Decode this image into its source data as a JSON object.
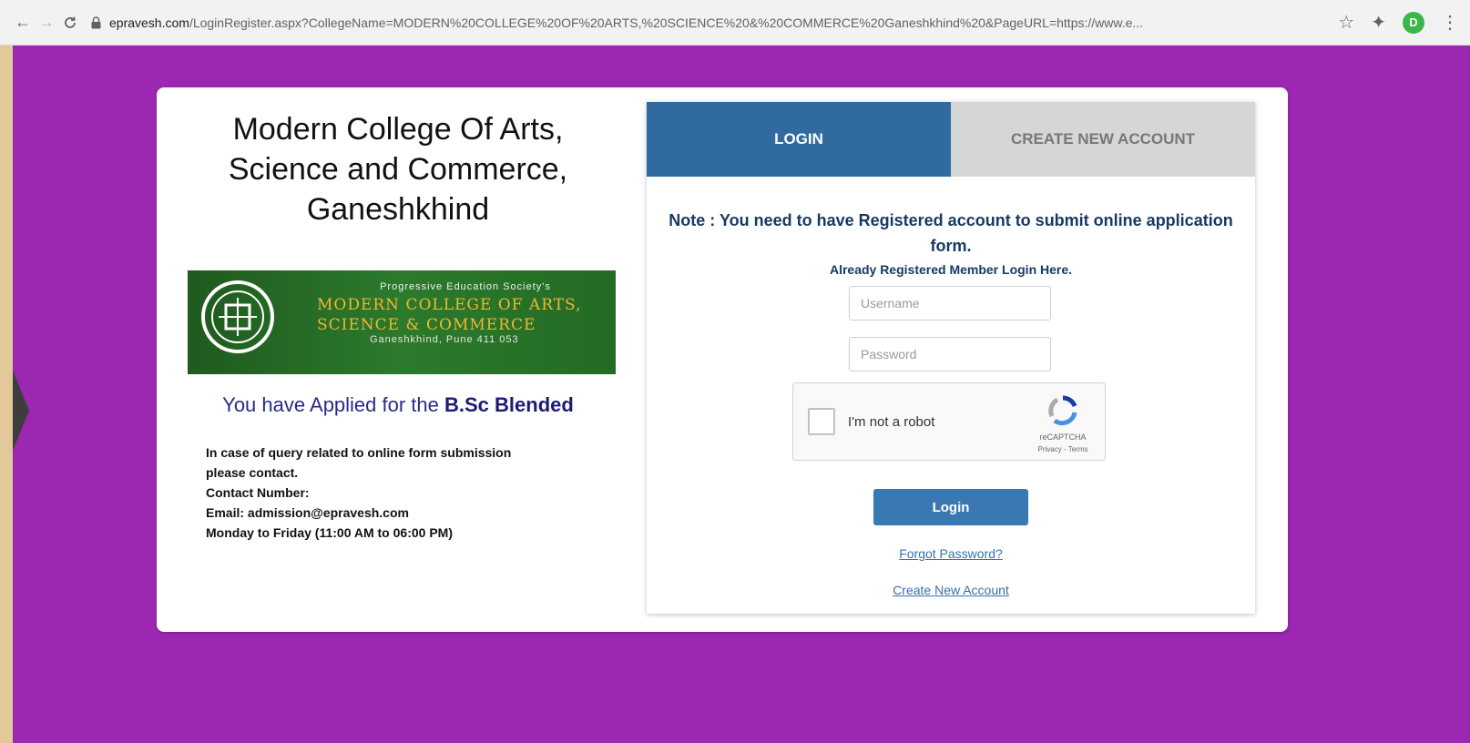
{
  "browser": {
    "url_host": "epravesh.com",
    "url_rest": "/LoginRegister.aspx?CollegeName=MODERN%20COLLEGE%20OF%20ARTS,%20SCIENCE%20&%20COMMERCE%20Ganeshkhind%20&PageURL=https://www.e...",
    "back_glyph": "←",
    "forward_glyph": "→",
    "reload_glyph": "C",
    "profile_initial": "D"
  },
  "college": {
    "title": "Modern College Of Arts, Science and Commerce, Ganeshkhind",
    "banner_society": "Progressive Education Society's",
    "banner_line1": "MODERN COLLEGE OF ARTS,",
    "banner_line2": "SCIENCE & COMMERCE",
    "banner_address": "Ganeshkhind, Pune 411 053",
    "applied_prefix": "You have Applied for the ",
    "applied_course": "B.Sc Blended",
    "contact_lines": [
      "In case of query related to online form submission",
      "please contact.",
      "Contact Number:",
      "Email: admission@epravesh.com",
      "Monday to Friday (11:00 AM to 06:00 PM)"
    ]
  },
  "tabs": {
    "login": "LOGIN",
    "create": "CREATE NEW ACCOUNT"
  },
  "login_form": {
    "note": "Note : You need to have Registered account to submit online application form.",
    "sub": "Already Registered Member Login Here.",
    "username_placeholder": "Username",
    "password_placeholder": "Password",
    "captcha_label": "I'm not a robot",
    "captcha_brand": "reCAPTCHA",
    "captcha_links": "Privacy - Terms",
    "login_button": "Login",
    "forgot_link": "Forgot Password?",
    "create_link": "Create New Account"
  },
  "colors": {
    "page_bg": "#9c27b0",
    "tab_active": "#306a9f",
    "button": "#3a78b3",
    "note_text": "#173a63"
  }
}
